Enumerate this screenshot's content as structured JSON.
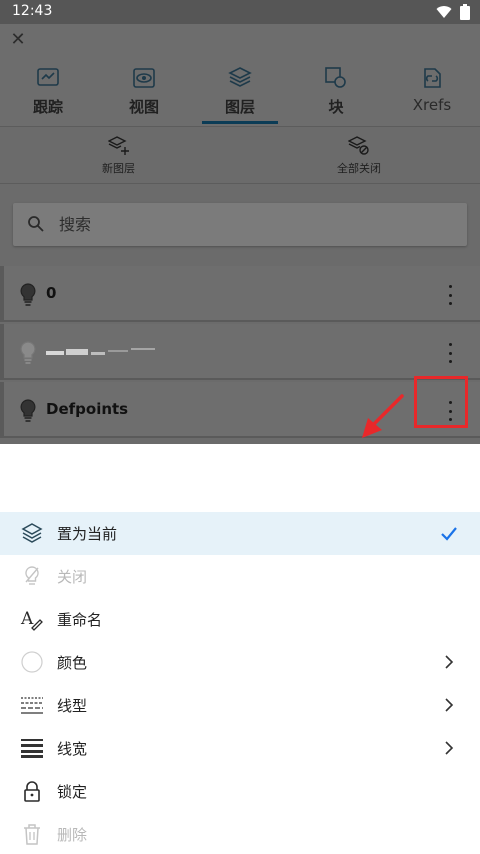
{
  "status_bar": {
    "time": "12:43"
  },
  "tabs": [
    {
      "label": "跟踪",
      "icon": "track-icon"
    },
    {
      "label": "视图",
      "icon": "view-icon"
    },
    {
      "label": "图层",
      "icon": "layers-icon",
      "active": true
    },
    {
      "label": "块",
      "icon": "block-icon"
    },
    {
      "label": "Xrefs",
      "icon": "xref-icon"
    }
  ],
  "actions": {
    "new_layer": "新图层",
    "all_off": "全部关闭"
  },
  "search": {
    "placeholder": "搜索"
  },
  "layers": [
    {
      "name": "0"
    },
    {
      "name": ""
    },
    {
      "name": "Defpoints"
    }
  ],
  "menu": {
    "set_current": "置为当前",
    "turn_off": "关闭",
    "rename": "重命名",
    "color": "颜色",
    "linetype": "线型",
    "lineweight": "线宽",
    "lock": "锁定",
    "delete": "删除"
  },
  "colors": {
    "accent": "#1a73e8",
    "highlight": "#e8282a",
    "selected_bg": "#e6f2f9"
  }
}
